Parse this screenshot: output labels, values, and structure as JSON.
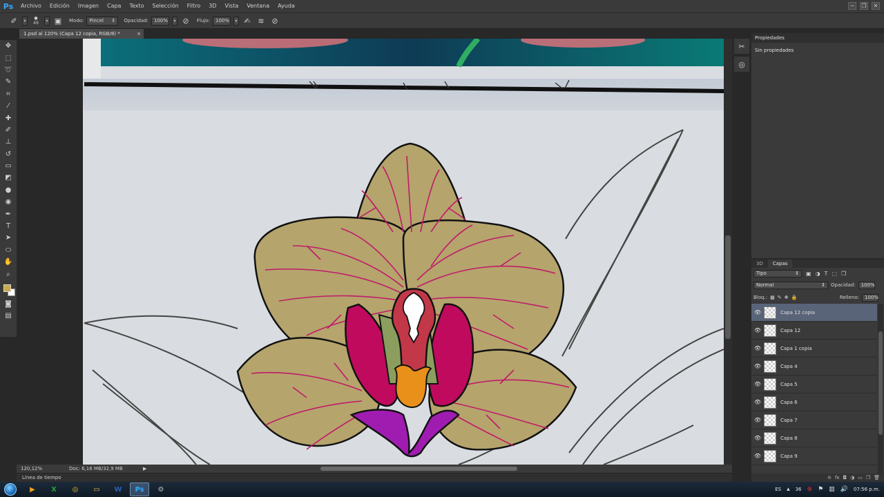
{
  "app": {
    "logo": "Ps",
    "menu": [
      "Archivo",
      "Edición",
      "Imagen",
      "Capa",
      "Texto",
      "Selección",
      "Filtro",
      "3D",
      "Vista",
      "Ventana",
      "Ayuda"
    ],
    "window_controls": [
      "−",
      "❐",
      "✕"
    ]
  },
  "options": {
    "brush_size": "49",
    "mode_label": "Modo:",
    "mode_value": "Pincel",
    "opacity_label": "Opacidad:",
    "opacity_value": "100%",
    "flow_label": "Flujo:",
    "flow_value": "100%"
  },
  "tools": [
    {
      "name": "move-tool-icon",
      "glyph": "✥"
    },
    {
      "name": "marquee-tool-icon",
      "glyph": "⬚"
    },
    {
      "name": "lasso-tool-icon",
      "glyph": "➰"
    },
    {
      "name": "quick-select-tool-icon",
      "glyph": "✎"
    },
    {
      "name": "crop-tool-icon",
      "glyph": "⌗"
    },
    {
      "name": "eyedropper-tool-icon",
      "glyph": "⁄"
    },
    {
      "name": "healing-brush-tool-icon",
      "glyph": "✚"
    },
    {
      "name": "brush-tool-icon",
      "glyph": "✐"
    },
    {
      "name": "clone-stamp-tool-icon",
      "glyph": "⊥"
    },
    {
      "name": "history-brush-tool-icon",
      "glyph": "↺"
    },
    {
      "name": "eraser-tool-icon",
      "glyph": "▭"
    },
    {
      "name": "paint-bucket-tool-icon",
      "glyph": "◩"
    },
    {
      "name": "blur-tool-icon",
      "glyph": "●"
    },
    {
      "name": "dodge-tool-icon",
      "glyph": "◉"
    },
    {
      "name": "pen-tool-icon",
      "glyph": "✒"
    },
    {
      "name": "type-tool-icon",
      "glyph": "T"
    },
    {
      "name": "path-select-tool-icon",
      "glyph": "➤"
    },
    {
      "name": "ellipse-tool-icon",
      "glyph": "⬭"
    },
    {
      "name": "hand-tool-icon",
      "glyph": "✋"
    },
    {
      "name": "zoom-tool-icon",
      "glyph": "⌕"
    }
  ],
  "colors": {
    "foreground": "#c9a94b",
    "background": "#ffffff"
  },
  "document": {
    "tab_title": "1.psd al 120% (Capa 12 copia, RGB/8) *",
    "close": "×",
    "zoom": "120,12%",
    "doc_info": "Doc: 6,16 MB/32,9 MB",
    "status_arrow": "▶"
  },
  "timeline": {
    "label": "Línea de tiempo"
  },
  "properties": {
    "tab": "Propiedades",
    "empty_text": "Sin propiedades"
  },
  "layers": {
    "tabs": [
      "3D",
      "Capas"
    ],
    "filter_type": "Tipo",
    "blend_mode": "Normal",
    "opacity_label": "Opacidad:",
    "opacity_value": "100%",
    "lock_label": "Bloq.:",
    "fill_label": "Relleno:",
    "fill_value": "100%",
    "items": [
      {
        "name": "Capa 12 copia",
        "selected": true
      },
      {
        "name": "Capa 12",
        "selected": false
      },
      {
        "name": "Capa 1 copia",
        "selected": false
      },
      {
        "name": "Capa 4",
        "selected": false
      },
      {
        "name": "Capa 5",
        "selected": false
      },
      {
        "name": "Capa 6",
        "selected": false
      },
      {
        "name": "Capa 7",
        "selected": false
      },
      {
        "name": "Capa 8",
        "selected": false
      },
      {
        "name": "Capa 9",
        "selected": false
      }
    ],
    "footer_icons": [
      "⊝",
      "fx",
      "◘",
      "◑",
      "▭",
      "❐",
      "🗑"
    ]
  },
  "taskbar": {
    "apps": [
      {
        "name": "media-player-icon",
        "glyph": "▶",
        "color": "#f0a020"
      },
      {
        "name": "excel-icon",
        "glyph": "X",
        "color": "#2e9b45"
      },
      {
        "name": "chrome-icon",
        "glyph": "◎",
        "color": "#e8c020"
      },
      {
        "name": "explorer-icon",
        "glyph": "▭",
        "color": "#e6c060"
      },
      {
        "name": "word-icon",
        "glyph": "W",
        "color": "#2b5fb4"
      },
      {
        "name": "photoshop-icon",
        "glyph": "Ps",
        "color": "#31a8ff",
        "active": true
      },
      {
        "name": "settings-app-icon",
        "glyph": "⚙",
        "color": "#bbbbbb"
      }
    ],
    "lang": "ES",
    "tray_number": "36",
    "clock": "07:56 p.m."
  }
}
